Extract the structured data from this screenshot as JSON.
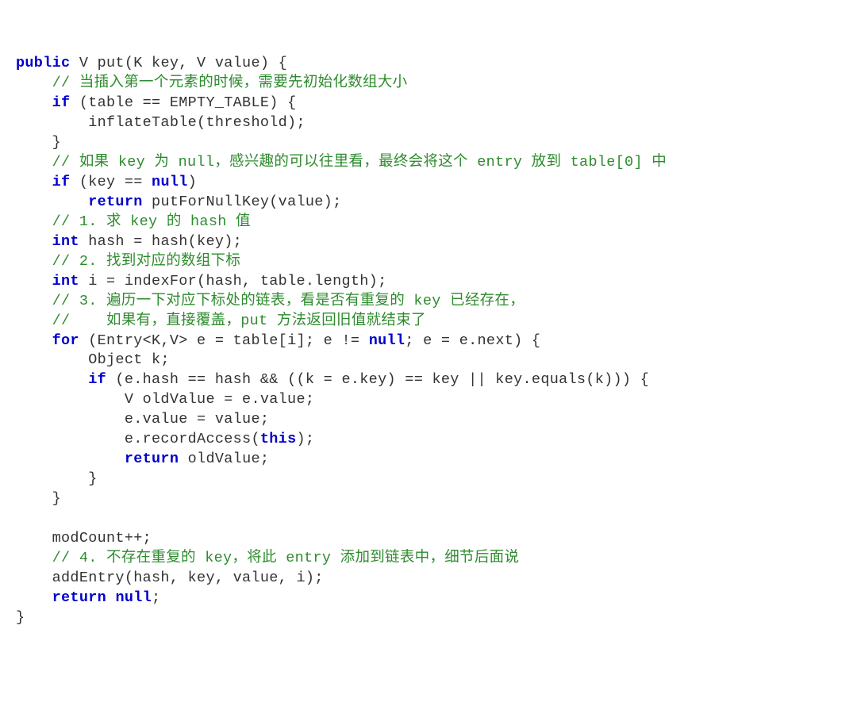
{
  "code": {
    "l01": {
      "kw1": "public",
      "t1": " V put(K key, V value) {"
    },
    "l02": {
      "c": "// 当插入第一个元素的时候，需要先初始化数组大小"
    },
    "l03": {
      "kw1": "if",
      "t1": " (table == EMPTY_TABLE) {"
    },
    "l04": {
      "t1": "inflateTable(threshold);"
    },
    "l05": {
      "t1": "}"
    },
    "l06": {
      "c": "// 如果 key 为 null，感兴趣的可以往里看，最终会将这个 entry 放到 table[0] 中"
    },
    "l07": {
      "kw1": "if",
      "t1": " (key == ",
      "kw2": "null",
      "t2": ")"
    },
    "l08": {
      "kw1": "return",
      "t1": " putForNullKey(value);"
    },
    "l09": {
      "c": "// 1. 求 key 的 hash 值"
    },
    "l10": {
      "kw1": "int",
      "t1": " hash = hash(key);"
    },
    "l11": {
      "c": "// 2. 找到对应的数组下标"
    },
    "l12": {
      "kw1": "int",
      "t1": " i = indexFor(hash, table.length);"
    },
    "l13": {
      "c": "// 3. 遍历一下对应下标处的链表，看是否有重复的 key 已经存在，"
    },
    "l14": {
      "c": "//    如果有，直接覆盖，put 方法返回旧值就结束了"
    },
    "l15": {
      "kw1": "for",
      "t1": " (Entry<K,V> e = table[i]; e != ",
      "kw2": "null",
      "t2": "; e = e.next) {"
    },
    "l16": {
      "t1": "Object k;"
    },
    "l17": {
      "kw1": "if",
      "t1": " (e.hash == hash && ((k = e.key) == key || key.equals(k))) {"
    },
    "l18": {
      "t1": "V oldValue = e.value;"
    },
    "l19": {
      "t1": "e.value = value;"
    },
    "l20": {
      "t1": "e.recordAccess(",
      "kw1": "this",
      "t2": ");"
    },
    "l21": {
      "kw1": "return",
      "t1": " oldValue;"
    },
    "l22": {
      "t1": "}"
    },
    "l23": {
      "t1": "}"
    },
    "l24": {
      "t1": "modCount++;"
    },
    "l25": {
      "c": "// 4. 不存在重复的 key，将此 entry 添加到链表中，细节后面说"
    },
    "l26": {
      "t1": "addEntry(hash, key, value, i);"
    },
    "l27": {
      "kw1": "return",
      "t1": " ",
      "kw2": "null",
      "t2": ";"
    },
    "l28": {
      "t1": "}"
    }
  }
}
